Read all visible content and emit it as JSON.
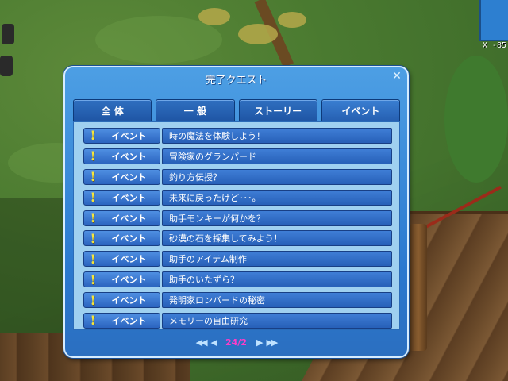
{
  "hud": {
    "coordinates": "X -85"
  },
  "window": {
    "title": "完了クエスト",
    "close_icon": "close-icon"
  },
  "tabs": [
    {
      "label": "全 体",
      "active": false
    },
    {
      "label": "一 般",
      "active": false
    },
    {
      "label": "ストーリー",
      "active": false
    },
    {
      "label": "イベント",
      "active": true
    }
  ],
  "quests": [
    {
      "category": "イベント",
      "name": "時の魔法を体験しよう！"
    },
    {
      "category": "イベント",
      "name": "冒険家のグランパード"
    },
    {
      "category": "イベント",
      "name": "釣り方伝授？"
    },
    {
      "category": "イベント",
      "name": "未来に戻ったけど･･･。"
    },
    {
      "category": "イベント",
      "name": "助手モンキーが何かを？"
    },
    {
      "category": "イベント",
      "name": "砂漠の石を採集してみよう！"
    },
    {
      "category": "イベント",
      "name": "助手のアイテム制作"
    },
    {
      "category": "イベント",
      "name": "助手のいたずら？"
    },
    {
      "category": "イベント",
      "name": "発明家ロンバードの秘密"
    },
    {
      "category": "イベント",
      "name": "メモリーの自由研究"
    }
  ],
  "pager": {
    "text": "24/2",
    "first_icon": "double-arrow-left-icon",
    "prev_icon": "arrow-left-icon",
    "next_icon": "arrow-right-icon",
    "last_icon": "double-arrow-right-icon"
  },
  "colors": {
    "window_blue": "#2a78cf",
    "list_bg": "#9fd0f0",
    "page_text": "#ff3cc7",
    "exclamation": "#f7e63a"
  }
}
